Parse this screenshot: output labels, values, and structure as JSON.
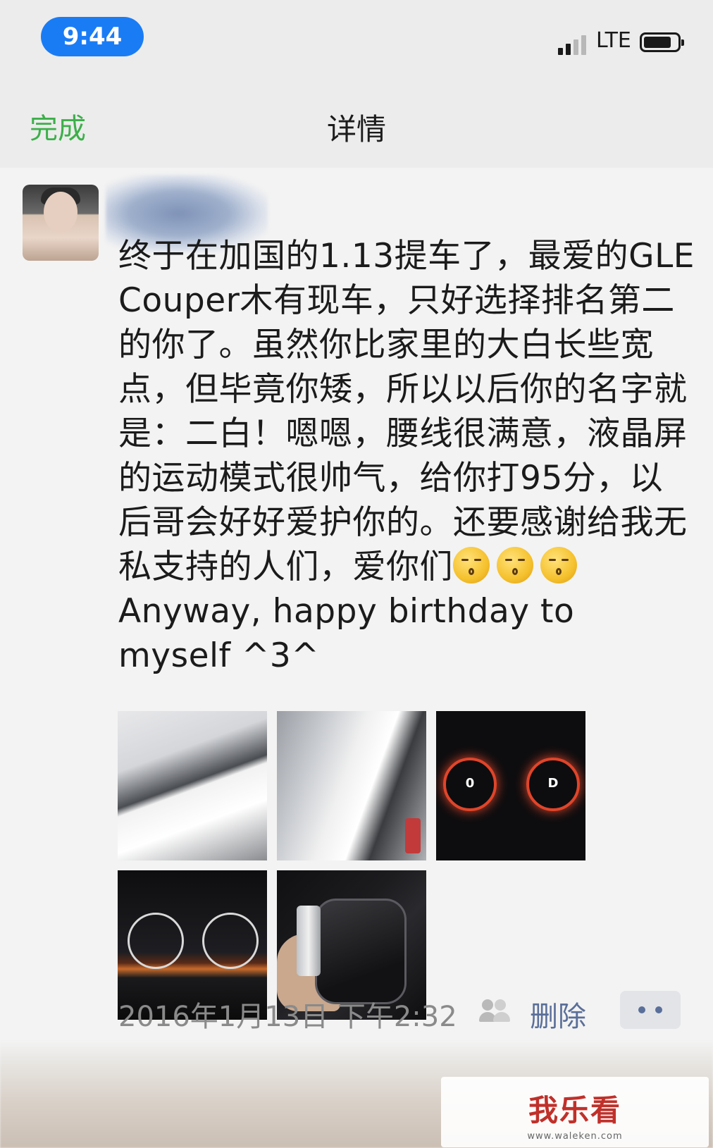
{
  "status_bar": {
    "time": "9:44",
    "network": "LTE",
    "signal_bars": 2,
    "battery_level": 0.75
  },
  "nav": {
    "done_label": "完成",
    "title": "详情"
  },
  "post": {
    "text": "终于在加国的1.13提车了，最爱的GLE Couper木有现车，只好选择排名第二的你了。虽然你比家里的大白长些宽点，但毕竟你矮，所以以后你的名字就是：二白！嗯嗯，腰线很满意，液晶屏的运动模式很帅气，给你打95分，以后哥会好好爱护你的。还要感谢给我无私支持的人们，爱你们",
    "text_after_emoji": "Anyway, happy birthday to myself ^3^",
    "emoji_count": 3,
    "emoji_name": "kissing-face-emoji",
    "photos": [
      {
        "name": "photo-white-suv-side"
      },
      {
        "name": "photo-white-suv-rear"
      },
      {
        "name": "photo-dashboard-sport-mode"
      },
      {
        "name": "photo-dashboard-gauges"
      },
      {
        "name": "photo-car-key-in-hand"
      }
    ],
    "timestamp": "2016年1月13日 下午2:32",
    "delete_label": "删除"
  },
  "watermark": {
    "logo_text": "我乐看",
    "url": "www.waleken.com"
  },
  "colors": {
    "accent_green": "#3daf4a",
    "link_blue": "#5a6f99",
    "time_pill": "#1a7cf5"
  }
}
